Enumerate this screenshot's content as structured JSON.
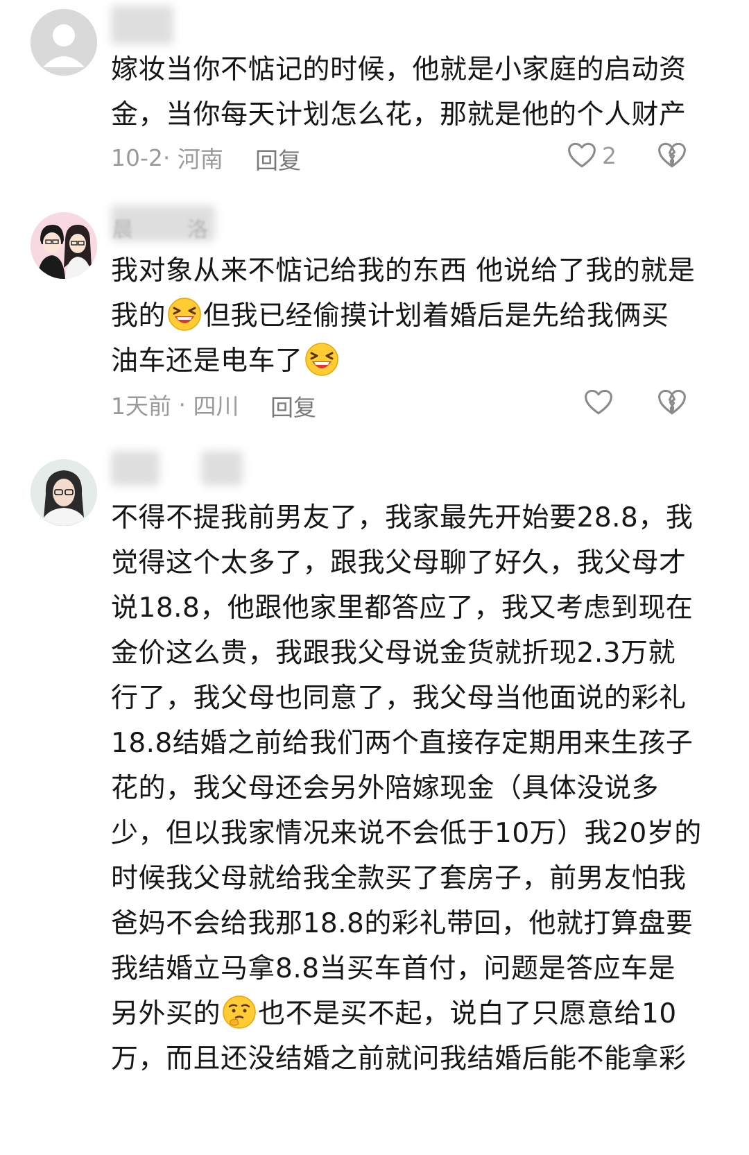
{
  "comments": [
    {
      "username": "",
      "content_lines": [
        "嫁妆当你不惦记的时候，他就是小家庭的启动资",
        "金，当你每天计划怎么花，那就是他的个人财产"
      ],
      "time": "10-2",
      "location": "河南",
      "reply_label": "回复",
      "like_count": "2"
    },
    {
      "username": "",
      "username_partial_a": "晨",
      "username_partial_b": "洛",
      "content_lines": [
        "我对象从来不惦记给我的东西 他说给了我的就是",
        "我的",
        "但我已经偷摸计划着婚后是先给我俩买",
        "油车还是电车了"
      ],
      "time": "1天前",
      "location": "四川",
      "reply_label": "回复",
      "like_count": ""
    },
    {
      "username": "",
      "content_lines": [
        "不得不提我前男友了，我家最先开始要28.8，我",
        "觉得这个太多了，跟我父母聊了好久，我父母才",
        "说18.8，他跟他家里都答应了，我又考虑到现在",
        "金价这么贵，我跟我父母说金货就折现2.3万就",
        "行了，我父母也同意了，我父母当他面说的彩礼",
        "18.8结婚之前给我们两个直接存定期用来生孩子",
        "花的，我父母还会另外陪嫁现金（具体没说多",
        "少，但以我家情况来说不会低于10万）我20岁的",
        "时候我父母就给我全款买了套房子，前男友怕我",
        "爸妈不会给我那18.8的彩礼带回，他就打算盘要",
        "我结婚立马拿8.8当买车首付，问题是答应车是",
        "另外买的",
        "也不是买不起，说白了只愿意给10",
        "万，而且还没结婚之前就问我结婚后能不能拿彩"
      ]
    }
  ],
  "icons": {
    "like": "heart-outline-icon",
    "dislike": "broken-heart-icon",
    "laugh_emoji": "grinning-squint-emoji",
    "thinking_emoji": "thinking-face-emoji"
  },
  "colors": {
    "text": "#161616",
    "meta": "#9a9a9a",
    "reply": "#7a7a7a",
    "icon": "#8a8a8a"
  }
}
